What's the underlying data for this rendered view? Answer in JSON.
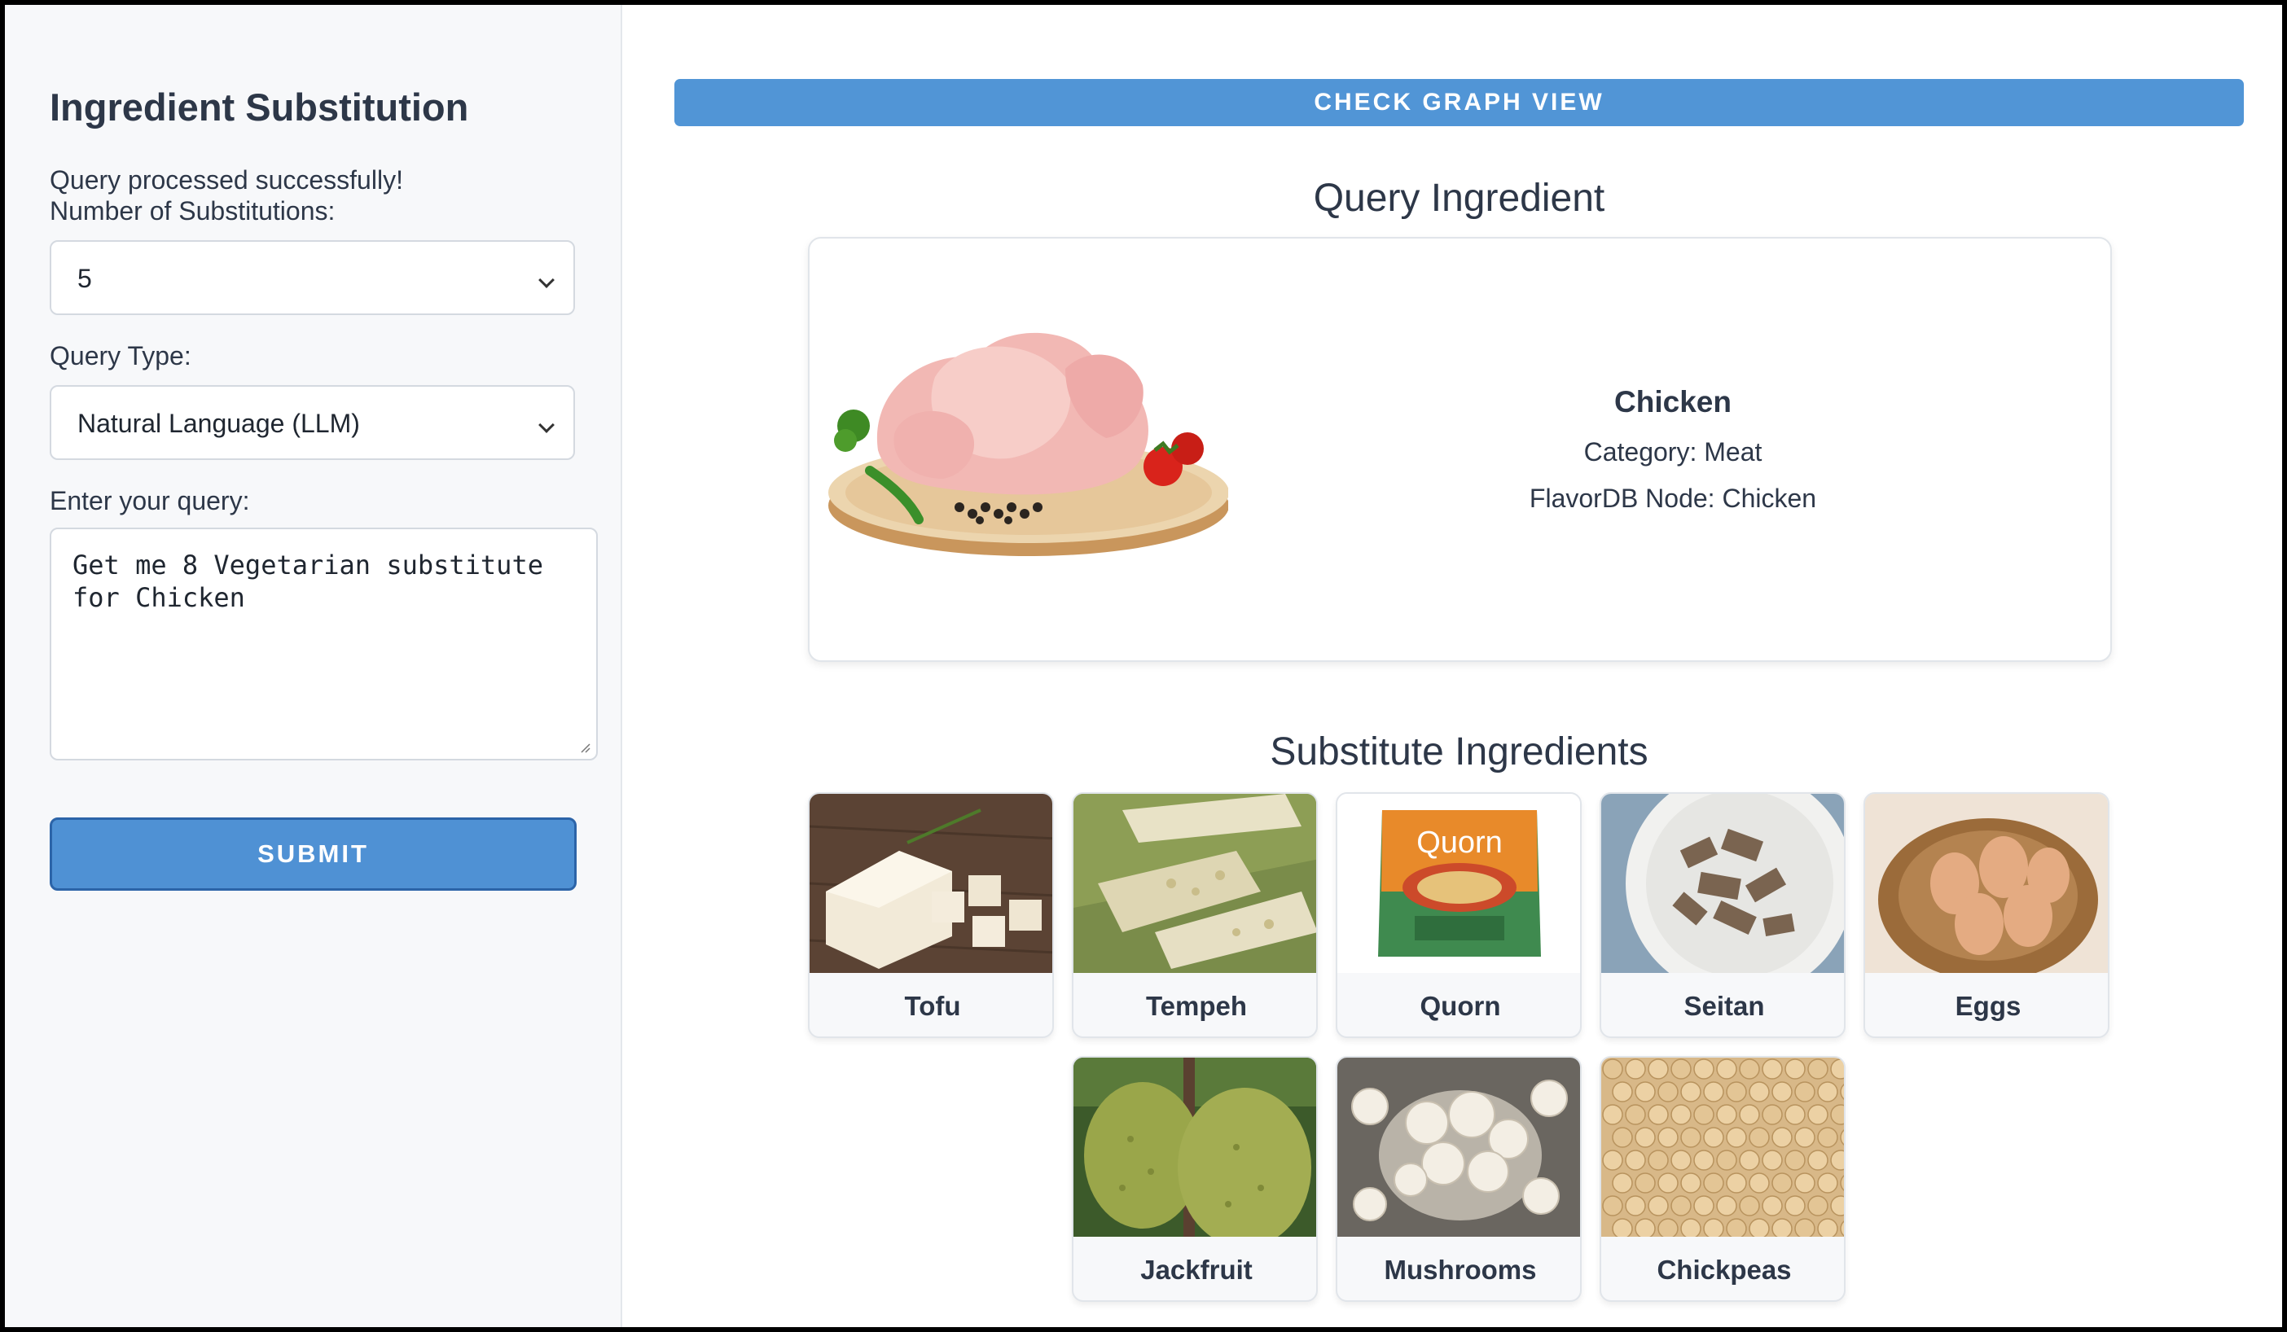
{
  "sidebar": {
    "title": "Ingredient Substitution",
    "status_message": "Query processed successfully!",
    "num_substitutions_label": "Number of Substitutions:",
    "num_substitutions_value": "5",
    "query_type_label": "Query Type:",
    "query_type_value": "Natural Language (LLM)",
    "query_label": "Enter your query:",
    "query_value": "Get me 8 Vegetarian substitute for Chicken",
    "submit_label": "SUBMIT"
  },
  "main": {
    "graph_button_label": "CHECK GRAPH VIEW",
    "query_section_title": "Query Ingredient",
    "query_ingredient": {
      "name": "Chicken",
      "category": "Category: Meat",
      "flavordb_node": "FlavorDB Node: Chicken"
    },
    "substitutes_section_title": "Substitute Ingredients",
    "substitutes": [
      {
        "name": "Tofu"
      },
      {
        "name": "Tempeh"
      },
      {
        "name": "Quorn",
        "package_brand": "Quorn"
      },
      {
        "name": "Seitan"
      },
      {
        "name": "Eggs"
      },
      {
        "name": "Jackfruit"
      },
      {
        "name": "Mushrooms"
      },
      {
        "name": "Chickpeas"
      }
    ]
  },
  "colors": {
    "primary_button": "#4f91d4",
    "sidebar_bg": "#f7f8fa",
    "text": "#2d3748"
  }
}
